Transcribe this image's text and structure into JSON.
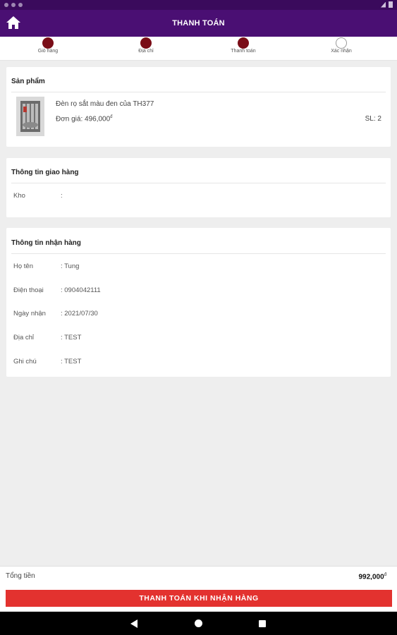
{
  "appbar": {
    "title": "THANH TOÁN",
    "icon": "home-icon",
    "color": "#4a0f73"
  },
  "stepper": {
    "steps": [
      {
        "label": "Giỏ hàng",
        "state": "done"
      },
      {
        "label": "Địa chỉ",
        "state": "done"
      },
      {
        "label": "Thanh toán",
        "state": "done"
      },
      {
        "label": "Xác nhận",
        "state": "pending"
      }
    ],
    "done_color": "#7a0d17"
  },
  "product_card": {
    "title": "Sản phẩm",
    "name": "Đèn rọ sắt màu đen của TH377",
    "price_label": "Đơn giá: 496,000",
    "currency": "đ",
    "qty": "SL: 2"
  },
  "shipping_card": {
    "title": "Thông tin giao hàng",
    "rows": [
      {
        "key": "Kho",
        "value": ":"
      }
    ]
  },
  "receiver_card": {
    "title": "Thông tin nhận hàng",
    "rows": [
      {
        "key": "Họ tên",
        "value": ": Tung"
      },
      {
        "key": "Điện thoại",
        "value": ": 0904042111"
      },
      {
        "key": "Ngày nhận",
        "value": ": 2021/07/30"
      },
      {
        "key": "Địa chỉ",
        "value": ": TEST"
      },
      {
        "key": "Ghi chú",
        "value": ": TEST"
      }
    ]
  },
  "footer": {
    "total_label": "Tổng tiền",
    "total_value": "992,000",
    "currency": "đ",
    "pay_button": "THANH TOÁN KHI NHẬN HÀNG",
    "pay_color": "#e3322f"
  }
}
